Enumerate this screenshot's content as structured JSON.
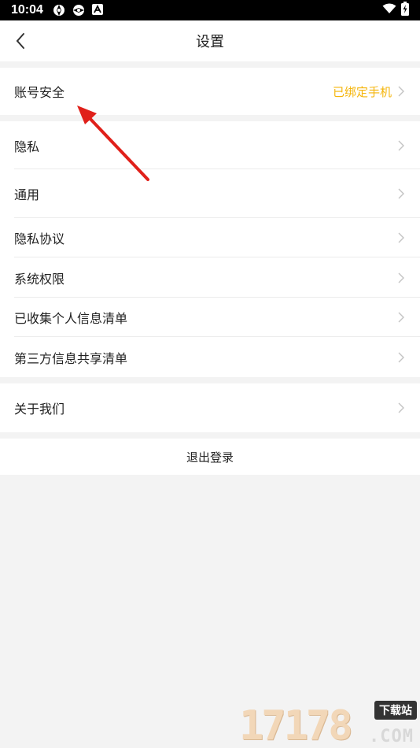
{
  "status_bar": {
    "time": "10:04",
    "icons": [
      "aperture-icon",
      "aperture-icon",
      "a-badge-icon"
    ],
    "right_icons": [
      "wifi-icon",
      "battery-charging-icon"
    ]
  },
  "header": {
    "title": "设置",
    "back_icon": "chevron-left-icon"
  },
  "groups": [
    {
      "items": [
        {
          "label": "账号安全",
          "value": "已绑定手机"
        }
      ]
    },
    {
      "items": [
        {
          "label": "隐私"
        },
        {
          "label": "通用"
        },
        {
          "label": "隐私协议"
        },
        {
          "label": "系统权限"
        },
        {
          "label": "已收集个人信息清单"
        },
        {
          "label": "第三方信息共享清单"
        }
      ]
    },
    {
      "items": [
        {
          "label": "关于我们"
        }
      ]
    }
  ],
  "logout_label": "退出登录",
  "colors": {
    "accent_value": "#f5b50a",
    "annotation_arrow": "#e0201a",
    "background": "#f3f3f3"
  },
  "watermark": {
    "digits": "17178",
    "tag": "下载站",
    "suffix": ".COM"
  }
}
